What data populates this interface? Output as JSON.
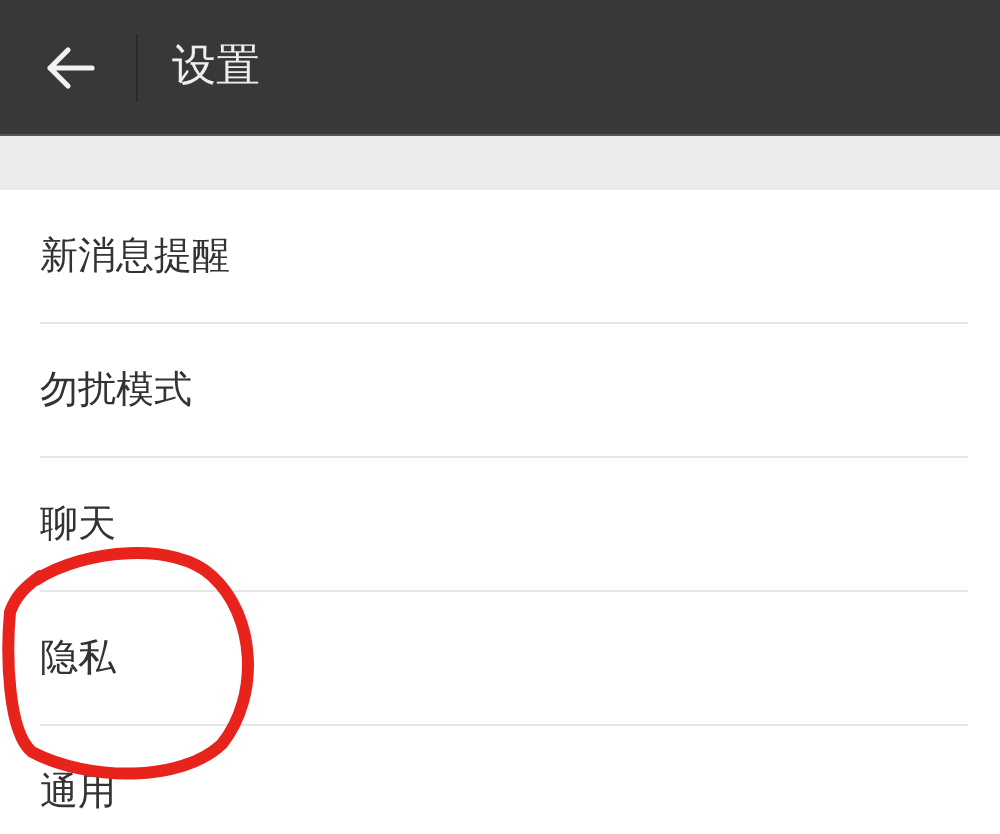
{
  "header": {
    "title": "设置"
  },
  "items": [
    {
      "label": "新消息提醒",
      "circled": false
    },
    {
      "label": "勿扰模式",
      "circled": false
    },
    {
      "label": "聊天",
      "circled": false
    },
    {
      "label": "隐私",
      "circled": true
    },
    {
      "label": "通用",
      "circled": false
    }
  ]
}
